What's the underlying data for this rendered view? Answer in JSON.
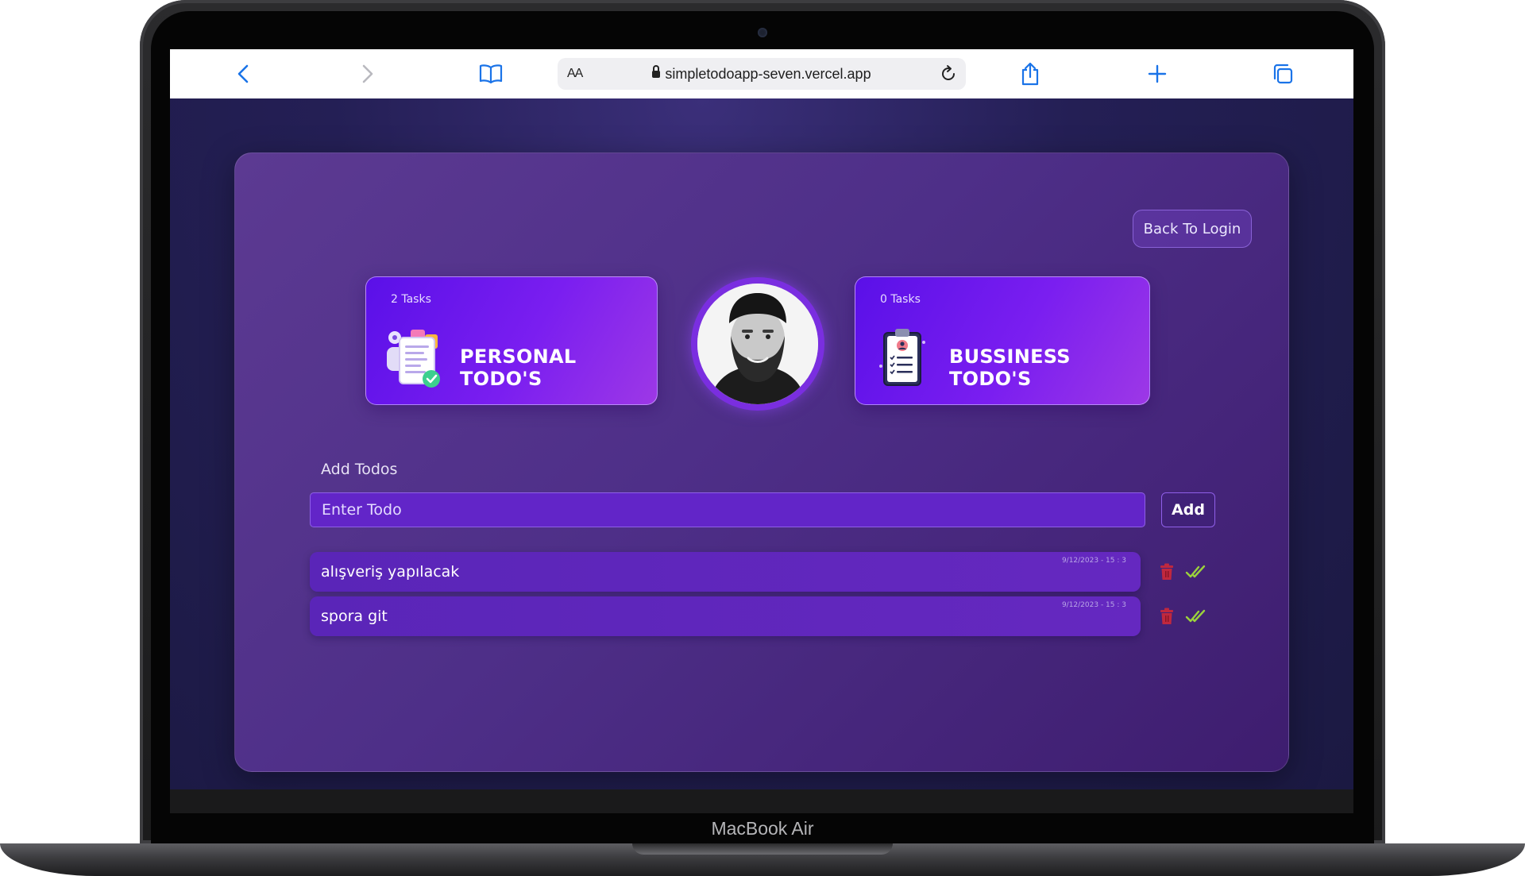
{
  "device": {
    "label": "MacBook Air"
  },
  "browser": {
    "address_aa": "AA",
    "url": "simpletodoapp-seven.vercel.app"
  },
  "app": {
    "back_button": "Back To Login",
    "categories": [
      {
        "count": "2 Tasks",
        "title": "PERSONAL TODO'S",
        "icon": "notes-checklist-icon"
      },
      {
        "count": "0 Tasks",
        "title": "BUSSINESS TODO'S",
        "icon": "clipboard-checklist-icon"
      }
    ],
    "add_todos_label": "Add Todos",
    "input": {
      "placeholder": "Enter Todo",
      "value": ""
    },
    "add_button": "Add",
    "todos": [
      {
        "text": "alışveriş yapılacak",
        "date": "9/12/2023 - 15 : 3"
      },
      {
        "text": "spora git",
        "date": "9/12/2023 - 15 : 3"
      }
    ]
  },
  "colors": {
    "accent": "#7a1ef0",
    "delete_icon": "#c0283e",
    "complete_icon": "#9bd23c"
  }
}
